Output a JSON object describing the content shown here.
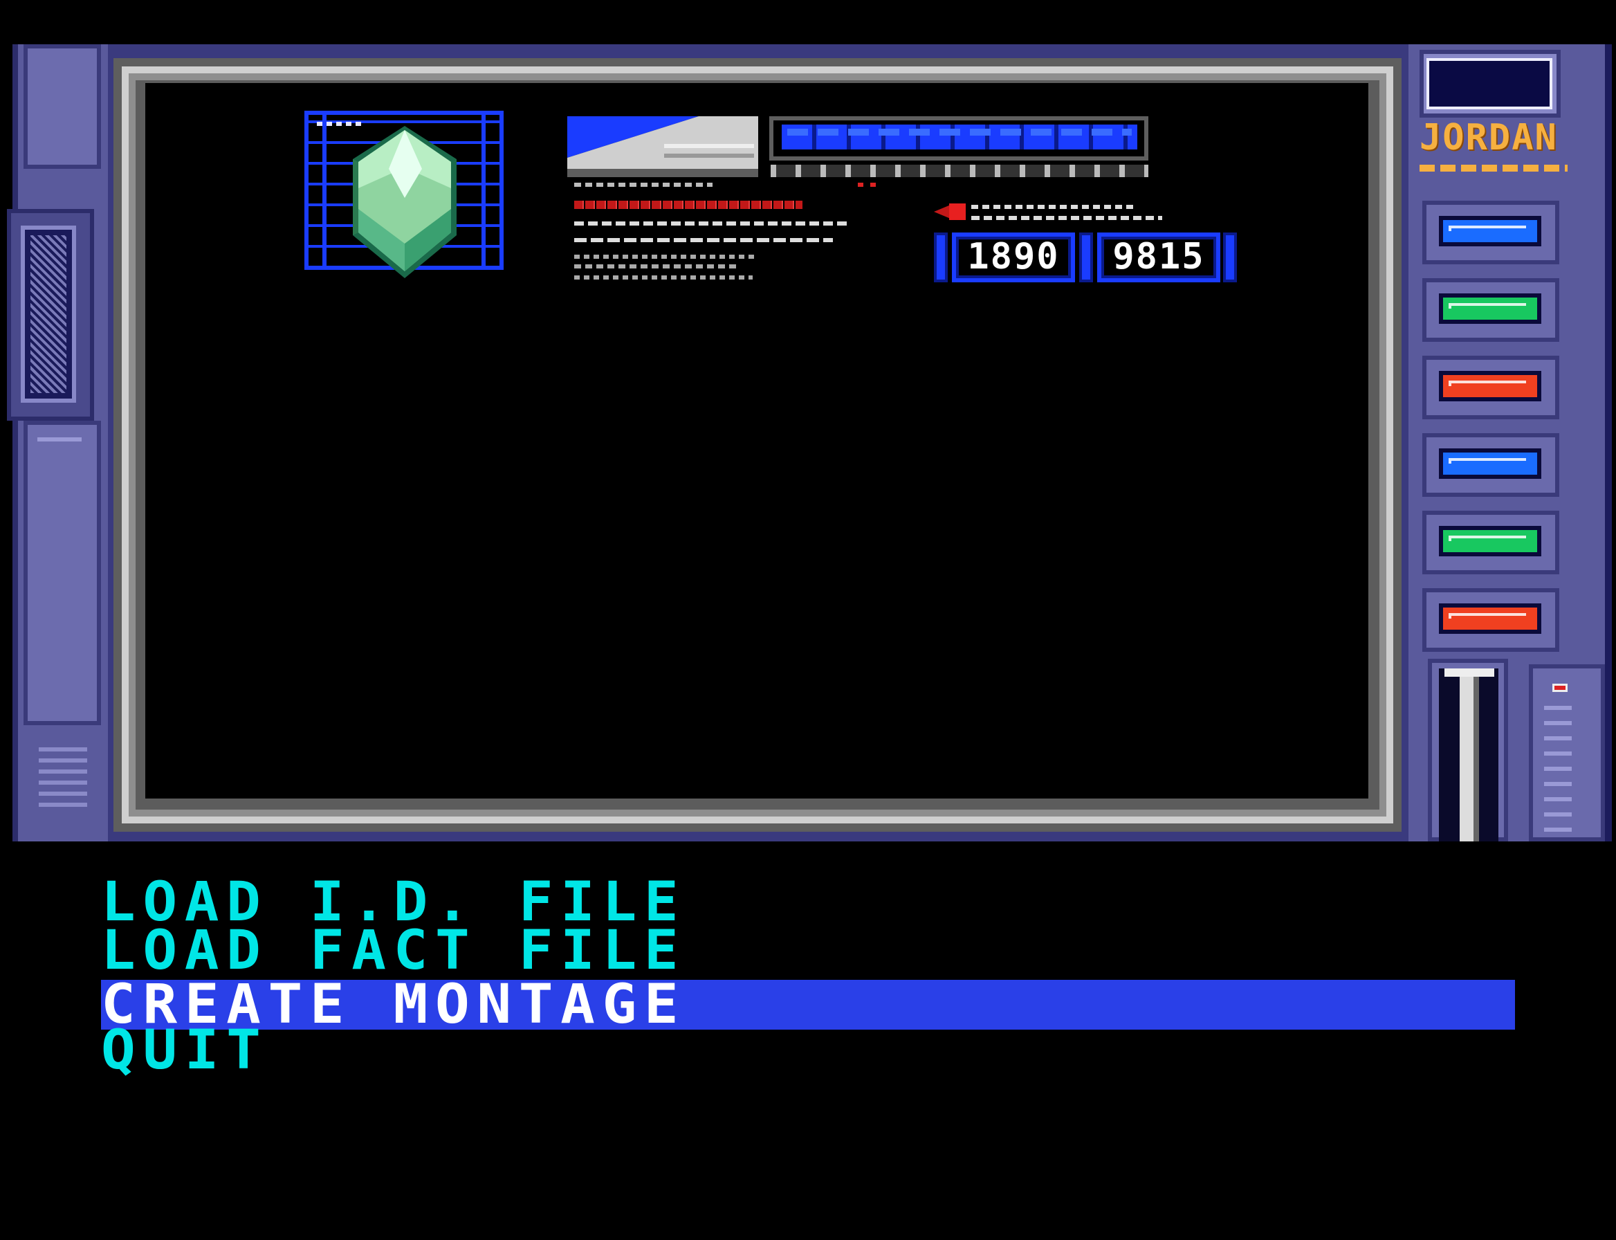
{
  "game_screen": {
    "operator_name": "JORDAN",
    "counters": [
      "1890",
      "9815"
    ],
    "indicator_lights": [
      {
        "color": "#1a6cff"
      },
      {
        "color": "#18c860"
      },
      {
        "color": "#f04020"
      },
      {
        "color": "#1a6cff"
      },
      {
        "color": "#18c860"
      },
      {
        "color": "#f04020"
      }
    ]
  },
  "menu": {
    "items": [
      "LOAD I.D. FILE",
      "LOAD FACT FILE",
      "CREATE MONTAGE",
      "QUIT"
    ],
    "selected": "CREATE MONTAGE"
  },
  "colors": {
    "menu_text": "#00e6e6",
    "menu_highlight": "#2a40e8",
    "panel": "#5a5a9c",
    "accent_blue": "#1a3cff"
  },
  "icons": [
    "crystal-icon",
    "pointer-arrow-icon"
  ]
}
